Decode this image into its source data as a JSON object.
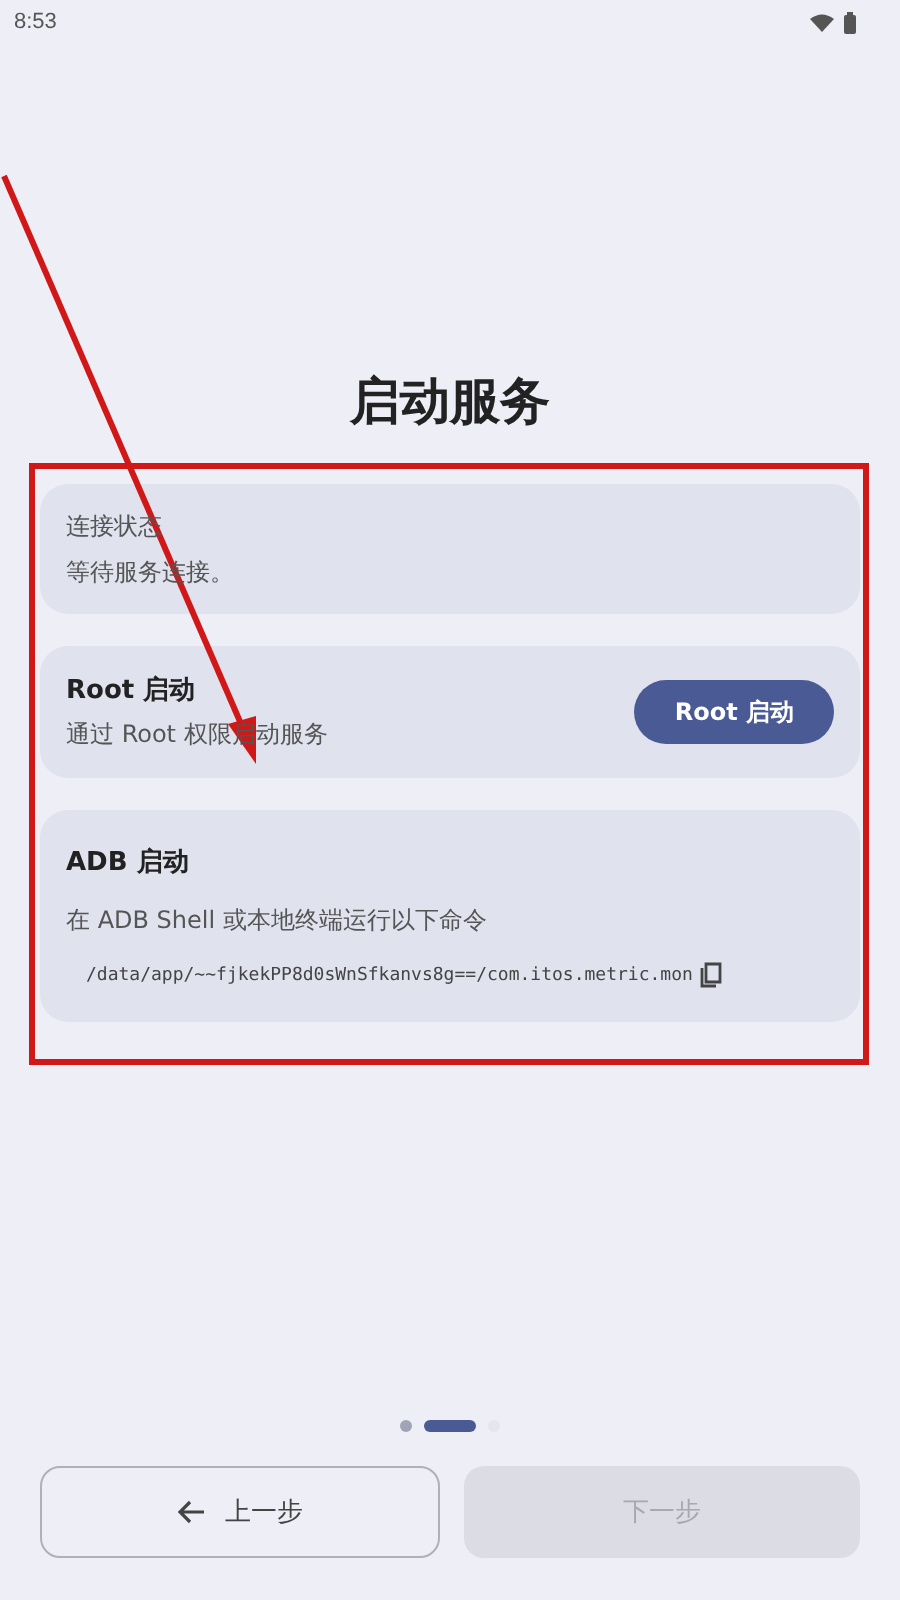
{
  "status_bar": {
    "time": "8:53"
  },
  "title": "启动服务",
  "status_card": {
    "label": "连接状态",
    "value": "等待服务连接。"
  },
  "root_card": {
    "title": "Root 启动",
    "description": "通过 Root 权限启动服务",
    "button": "Root 启动"
  },
  "adb_card": {
    "title": "ADB 启动",
    "description": "在 ADB Shell 或本地终端运行以下命令",
    "command": "/data/app/~~fjkekPP8d0sWnSfkanvs8g==/com.itos.metric.mon"
  },
  "pages": [
    {
      "selected": false
    },
    {
      "selected": true
    },
    {
      "selected": false
    }
  ],
  "back_button": {
    "label": "上一步",
    "disabled": false
  },
  "next_button": {
    "label": "下一步",
    "disabled": true
  },
  "annotations": {
    "arrow": true,
    "frame": true
  }
}
